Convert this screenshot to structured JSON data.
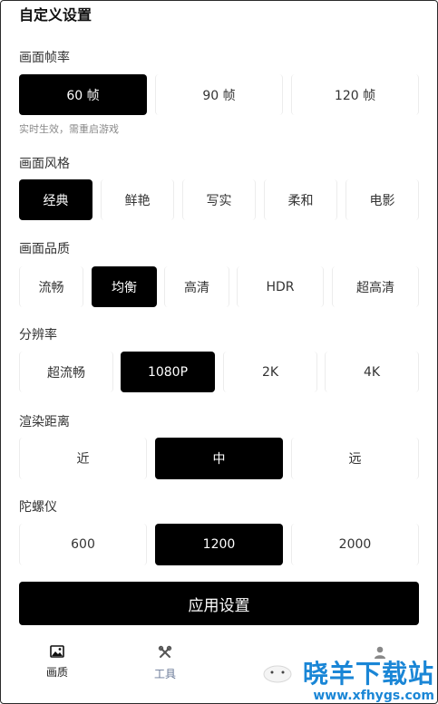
{
  "title": "自定义设置",
  "sections": {
    "fps": {
      "title": "画面帧率",
      "options": [
        "60 帧",
        "90 帧",
        "120 帧"
      ],
      "selected": "60 帧",
      "hint": "实时生效，需重启游戏"
    },
    "style": {
      "title": "画面风格",
      "options": [
        "经典",
        "鲜艳",
        "写实",
        "柔和",
        "电影"
      ],
      "selected": "经典"
    },
    "quality": {
      "title": "画面品质",
      "options": [
        "流畅",
        "均衡",
        "高清",
        "HDR",
        "超高清"
      ],
      "selected": "均衡"
    },
    "resolution": {
      "title": "分辨率",
      "options": [
        "超流畅",
        "1080P",
        "2K",
        "4K"
      ],
      "selected": "1080P"
    },
    "render_distance": {
      "title": "渲染距离",
      "options": [
        "近",
        "中",
        "远"
      ],
      "selected": "中"
    },
    "gyro": {
      "title": "陀螺仪",
      "options": [
        "600",
        "1200",
        "2000"
      ],
      "selected": "1200"
    }
  },
  "apply_button": "应用设置",
  "bottom_nav": [
    {
      "label": "画质",
      "icon": "image-icon"
    },
    {
      "label": "工具",
      "icon": "tools-icon"
    },
    {
      "label": "",
      "icon": "user-icon"
    }
  ],
  "watermark": {
    "title": "晓羊下载站",
    "url": "www.xfhygs.com"
  },
  "colors": {
    "selected_bg": "#000000",
    "selected_text": "#ffffff",
    "watermark": "#1a86d6",
    "tools_label": "#6a7a98"
  }
}
